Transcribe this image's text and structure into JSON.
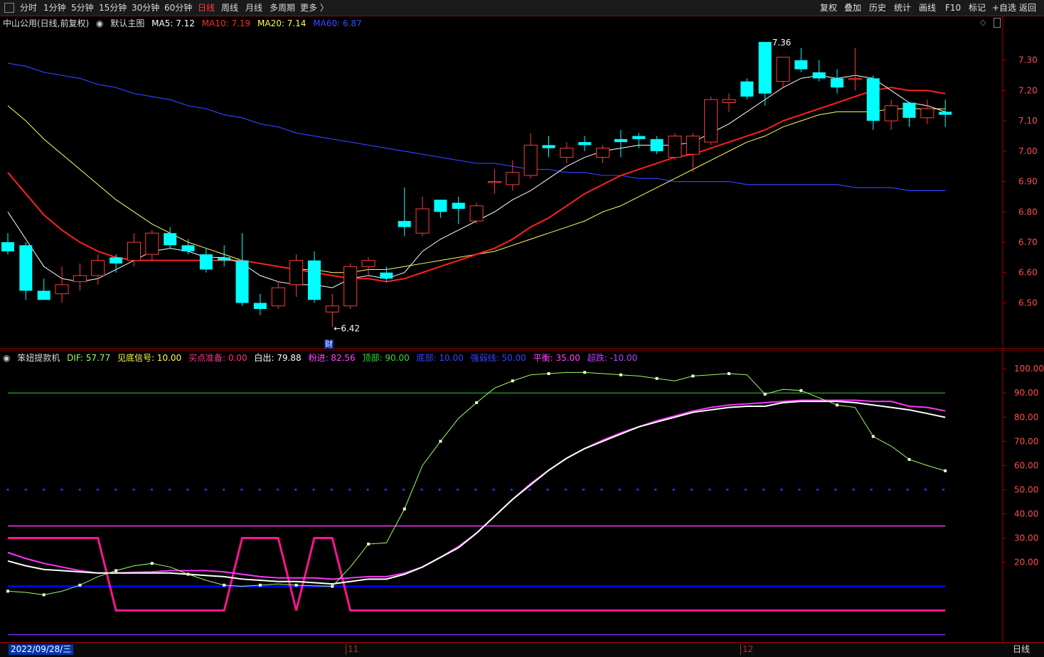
{
  "toolbar": {
    "periods": [
      "分时",
      "1分钟",
      "5分钟",
      "15分钟",
      "30分钟",
      "60分钟",
      "日线",
      "周线",
      "月线",
      "多周期",
      "更多 〉"
    ],
    "active_period": "日线",
    "right_buttons": [
      "复权",
      "叠加",
      "历史",
      "统计",
      "画线",
      "F10",
      "标记",
      "+自选",
      "返回"
    ]
  },
  "main_legend": {
    "stock": "中山公用(日线,前复权)",
    "indicator": "默认主图",
    "ma5": "MA5: 7.12",
    "ma10": "MA10: 7.19",
    "ma20": "MA20: 7.14",
    "ma60": "MA60: 6.87"
  },
  "main_annotations": {
    "high": "7.36",
    "low": "6.42",
    "low_arrow": "←6.42",
    "cai": "财"
  },
  "sub_legend": {
    "name": "笨妞提款机",
    "dif": "DIF: 57.77",
    "jdxh": "见底信号: 10.00",
    "mdzb": "买点准备: 0.00",
    "bc": "白出: 79.88",
    "fj": "粉进: 82.56",
    "db": "顶部: 90.00",
    "dibu": "底部: 10.00",
    "qrfj": "强弱线: 50.00",
    "ph": "平衡: 35.00",
    "cd": "超跌: -10.00"
  },
  "bottom": {
    "date": "2022/09/28/三",
    "month11": "11",
    "month12": "12",
    "period": "日线"
  },
  "colors": {
    "bg": "#000000",
    "up": "#ff3b3b",
    "down": "#00ffff",
    "ma5": "#ffffff",
    "ma10": "#ff2020",
    "ma20": "#ffff66",
    "ma60": "#2f3fff",
    "dif": "#99ff66",
    "pink": "#ff1493",
    "magenta": "#ff33ff",
    "blue": "#0000ff",
    "green": "#33cc33"
  },
  "chart_data": [
    {
      "type": "candlestick",
      "title": "中山公用(日线,前复权)",
      "y_ticks": [
        7.3,
        7.2,
        7.1,
        7.0,
        6.9,
        6.8,
        6.7,
        6.6,
        6.5
      ],
      "ylim": [
        6.42,
        7.36
      ],
      "candles": [
        {
          "o": 6.7,
          "h": 6.73,
          "l": 6.66,
          "c": 6.67
        },
        {
          "o": 6.69,
          "h": 6.7,
          "l": 6.51,
          "c": 6.54
        },
        {
          "o": 6.54,
          "h": 6.58,
          "l": 6.51,
          "c": 6.51
        },
        {
          "o": 6.53,
          "h": 6.62,
          "l": 6.5,
          "c": 6.56
        },
        {
          "o": 6.57,
          "h": 6.63,
          "l": 6.54,
          "c": 6.59
        },
        {
          "o": 6.59,
          "h": 6.66,
          "l": 6.56,
          "c": 6.64
        },
        {
          "o": 6.65,
          "h": 6.66,
          "l": 6.6,
          "c": 6.63
        },
        {
          "o": 6.64,
          "h": 6.73,
          "l": 6.62,
          "c": 6.7
        },
        {
          "o": 6.66,
          "h": 6.74,
          "l": 6.64,
          "c": 6.73
        },
        {
          "o": 6.73,
          "h": 6.75,
          "l": 6.68,
          "c": 6.69
        },
        {
          "o": 6.69,
          "h": 6.71,
          "l": 6.66,
          "c": 6.67
        },
        {
          "o": 6.66,
          "h": 6.68,
          "l": 6.6,
          "c": 6.61
        },
        {
          "o": 6.65,
          "h": 6.69,
          "l": 6.62,
          "c": 6.64
        },
        {
          "o": 6.64,
          "h": 6.73,
          "l": 6.49,
          "c": 6.5
        },
        {
          "o": 6.5,
          "h": 6.53,
          "l": 6.46,
          "c": 6.48
        },
        {
          "o": 6.49,
          "h": 6.57,
          "l": 6.48,
          "c": 6.55
        },
        {
          "o": 6.56,
          "h": 6.66,
          "l": 6.52,
          "c": 6.64
        },
        {
          "o": 6.64,
          "h": 6.67,
          "l": 6.5,
          "c": 6.51
        },
        {
          "o": 6.47,
          "h": 6.53,
          "l": 6.42,
          "c": 6.49
        },
        {
          "o": 6.49,
          "h": 6.63,
          "l": 6.48,
          "c": 6.62
        },
        {
          "o": 6.62,
          "h": 6.65,
          "l": 6.59,
          "c": 6.64
        },
        {
          "o": 6.6,
          "h": 6.62,
          "l": 6.57,
          "c": 6.58
        },
        {
          "o": 6.77,
          "h": 6.88,
          "l": 6.72,
          "c": 6.75
        },
        {
          "o": 6.73,
          "h": 6.85,
          "l": 6.72,
          "c": 6.81
        },
        {
          "o": 6.84,
          "h": 6.84,
          "l": 6.78,
          "c": 6.8
        },
        {
          "o": 6.83,
          "h": 6.85,
          "l": 6.76,
          "c": 6.81
        },
        {
          "o": 6.77,
          "h": 6.83,
          "l": 6.76,
          "c": 6.82
        },
        {
          "o": 6.9,
          "h": 6.94,
          "l": 6.86,
          "c": 6.9
        },
        {
          "o": 6.89,
          "h": 6.97,
          "l": 6.87,
          "c": 6.93
        },
        {
          "o": 6.92,
          "h": 7.06,
          "l": 6.91,
          "c": 7.02
        },
        {
          "o": 7.02,
          "h": 7.05,
          "l": 6.98,
          "c": 7.01
        },
        {
          "o": 6.98,
          "h": 7.03,
          "l": 6.96,
          "c": 7.01
        },
        {
          "o": 7.03,
          "h": 7.05,
          "l": 7.0,
          "c": 7.02
        },
        {
          "o": 6.98,
          "h": 7.02,
          "l": 6.96,
          "c": 7.01
        },
        {
          "o": 7.04,
          "h": 7.07,
          "l": 6.98,
          "c": 7.03
        },
        {
          "o": 7.05,
          "h": 7.06,
          "l": 7.01,
          "c": 7.04
        },
        {
          "o": 7.04,
          "h": 7.05,
          "l": 6.99,
          "c": 7.0
        },
        {
          "o": 6.98,
          "h": 7.06,
          "l": 6.97,
          "c": 7.05
        },
        {
          "o": 6.99,
          "h": 7.06,
          "l": 6.93,
          "c": 7.05
        },
        {
          "o": 7.03,
          "h": 7.18,
          "l": 7.02,
          "c": 7.17
        },
        {
          "o": 7.16,
          "h": 7.19,
          "l": 7.13,
          "c": 7.17
        },
        {
          "o": 7.23,
          "h": 7.24,
          "l": 7.17,
          "c": 7.18
        },
        {
          "o": 7.36,
          "h": 7.36,
          "l": 7.15,
          "c": 7.19
        },
        {
          "o": 7.23,
          "h": 7.31,
          "l": 7.21,
          "c": 7.31
        },
        {
          "o": 7.3,
          "h": 7.34,
          "l": 7.26,
          "c": 7.27
        },
        {
          "o": 7.26,
          "h": 7.3,
          "l": 7.23,
          "c": 7.24
        },
        {
          "o": 7.24,
          "h": 7.27,
          "l": 7.19,
          "c": 7.21
        },
        {
          "o": 7.24,
          "h": 7.34,
          "l": 7.2,
          "c": 7.24
        },
        {
          "o": 7.24,
          "h": 7.25,
          "l": 7.07,
          "c": 7.1
        },
        {
          "o": 7.1,
          "h": 7.17,
          "l": 7.07,
          "c": 7.15
        },
        {
          "o": 7.16,
          "h": 7.16,
          "l": 7.08,
          "c": 7.11
        },
        {
          "o": 7.11,
          "h": 7.17,
          "l": 7.09,
          "c": 7.14
        },
        {
          "o": 7.13,
          "h": 7.17,
          "l": 7.08,
          "c": 7.12
        }
      ],
      "ma5": [
        6.8,
        6.71,
        6.62,
        6.58,
        6.57,
        6.58,
        6.61,
        6.64,
        6.67,
        6.68,
        6.67,
        6.65,
        6.65,
        6.63,
        6.59,
        6.57,
        6.56,
        6.56,
        6.55,
        6.58,
        6.59,
        6.58,
        6.6,
        6.67,
        6.71,
        6.74,
        6.77,
        6.8,
        6.84,
        6.87,
        6.91,
        6.95,
        6.98,
        7.0,
        7.01,
        7.02,
        7.02,
        7.02,
        7.03,
        7.06,
        7.09,
        7.13,
        7.17,
        7.21,
        7.24,
        7.25,
        7.24,
        7.25,
        7.24,
        7.2,
        7.16,
        7.15,
        7.13
      ],
      "ma10": [
        6.93,
        6.86,
        6.79,
        6.74,
        6.7,
        6.67,
        6.65,
        6.64,
        6.64,
        6.64,
        6.64,
        6.64,
        6.64,
        6.64,
        6.63,
        6.62,
        6.61,
        6.6,
        6.59,
        6.58,
        6.58,
        6.57,
        6.58,
        6.6,
        6.62,
        6.64,
        6.66,
        6.68,
        6.71,
        6.75,
        6.78,
        6.82,
        6.86,
        6.89,
        6.92,
        6.94,
        6.96,
        6.98,
        6.99,
        7.01,
        7.03,
        7.05,
        7.07,
        7.1,
        7.12,
        7.14,
        7.16,
        7.18,
        7.2,
        7.21,
        7.2,
        7.2,
        7.19
      ],
      "ma20": [
        7.15,
        7.1,
        7.04,
        6.99,
        6.94,
        6.89,
        6.84,
        6.8,
        6.76,
        6.73,
        6.7,
        6.68,
        6.66,
        6.64,
        6.63,
        6.62,
        6.61,
        6.61,
        6.6,
        6.6,
        6.61,
        6.61,
        6.62,
        6.63,
        6.64,
        6.65,
        6.66,
        6.67,
        6.69,
        6.71,
        6.73,
        6.75,
        6.77,
        6.8,
        6.82,
        6.85,
        6.88,
        6.91,
        6.94,
        6.97,
        7.0,
        7.03,
        7.05,
        7.08,
        7.1,
        7.12,
        7.13,
        7.13,
        7.13,
        7.14,
        7.14,
        7.14,
        7.14
      ],
      "ma60": [
        7.29,
        7.28,
        7.26,
        7.25,
        7.24,
        7.22,
        7.21,
        7.19,
        7.18,
        7.17,
        7.15,
        7.14,
        7.12,
        7.11,
        7.09,
        7.08,
        7.06,
        7.05,
        7.04,
        7.03,
        7.02,
        7.01,
        7.0,
        6.99,
        6.98,
        6.97,
        6.96,
        6.96,
        6.95,
        6.94,
        6.94,
        6.93,
        6.93,
        6.92,
        6.92,
        6.91,
        6.91,
        6.9,
        6.9,
        6.9,
        6.9,
        6.89,
        6.89,
        6.89,
        6.89,
        6.89,
        6.89,
        6.88,
        6.88,
        6.88,
        6.87,
        6.87,
        6.87
      ]
    },
    {
      "type": "line",
      "title": "笨妞提款机",
      "y_ticks": [
        100.0,
        90.0,
        80.0,
        70.0,
        60.0,
        50.0,
        40.0,
        30.0,
        20.0
      ],
      "ylim": [
        -10,
        100
      ],
      "hlines": {
        "top": 90,
        "strong": 50,
        "balance": 35,
        "bottom": 10,
        "oversold": -10
      },
      "dif": [
        8.0,
        7.5,
        6.5,
        8.0,
        10.5,
        14.0,
        16.5,
        18.5,
        19.5,
        18.0,
        15.0,
        12.5,
        10.5,
        10.0,
        10.5,
        11.0,
        10.5,
        10.2,
        10.0,
        18.0,
        27.5,
        28.0,
        42.0,
        60.0,
        70.0,
        79.5,
        86.0,
        92.0,
        95.0,
        97.5,
        98.0,
        98.5,
        98.5,
        98.0,
        97.5,
        97.0,
        96.0,
        95.0,
        97.0,
        97.5,
        98.0,
        97.5,
        89.5,
        91.5,
        91.0,
        88.0,
        85.0,
        84.0,
        72.0,
        68.0,
        62.5,
        60.0,
        57.8
      ],
      "bai": [
        20.5,
        18.5,
        17.0,
        16.5,
        16.0,
        15.5,
        15.5,
        15.5,
        15.5,
        15.5,
        15.0,
        14.5,
        14.0,
        13.0,
        12.5,
        12.0,
        12.0,
        11.5,
        11.0,
        12.0,
        13.0,
        13.0,
        15.0,
        18.0,
        22.0,
        26.0,
        32.0,
        39.0,
        46.0,
        52.0,
        58.0,
        63.0,
        67.0,
        70.0,
        73.0,
        76.0,
        78.0,
        80.0,
        82.0,
        83.0,
        84.0,
        84.5,
        84.5,
        86.0,
        86.5,
        86.5,
        86.5,
        86.0,
        85.0,
        84.0,
        83.0,
        81.5,
        79.9
      ],
      "fen": [
        24.0,
        21.5,
        19.5,
        18.0,
        16.5,
        15.5,
        15.5,
        15.8,
        16.0,
        16.5,
        16.5,
        16.5,
        16.0,
        15.0,
        14.0,
        13.5,
        13.5,
        13.5,
        13.0,
        13.5,
        14.0,
        14.0,
        15.5,
        18.0,
        22.0,
        26.5,
        32.0,
        39.0,
        46.0,
        52.5,
        58.0,
        63.0,
        67.0,
        70.5,
        73.5,
        76.0,
        78.5,
        80.5,
        82.5,
        84.0,
        85.0,
        85.5,
        86.0,
        86.5,
        87.0,
        87.0,
        87.0,
        87.0,
        86.5,
        86.5,
        84.5,
        84.0,
        82.6
      ]
    }
  ]
}
